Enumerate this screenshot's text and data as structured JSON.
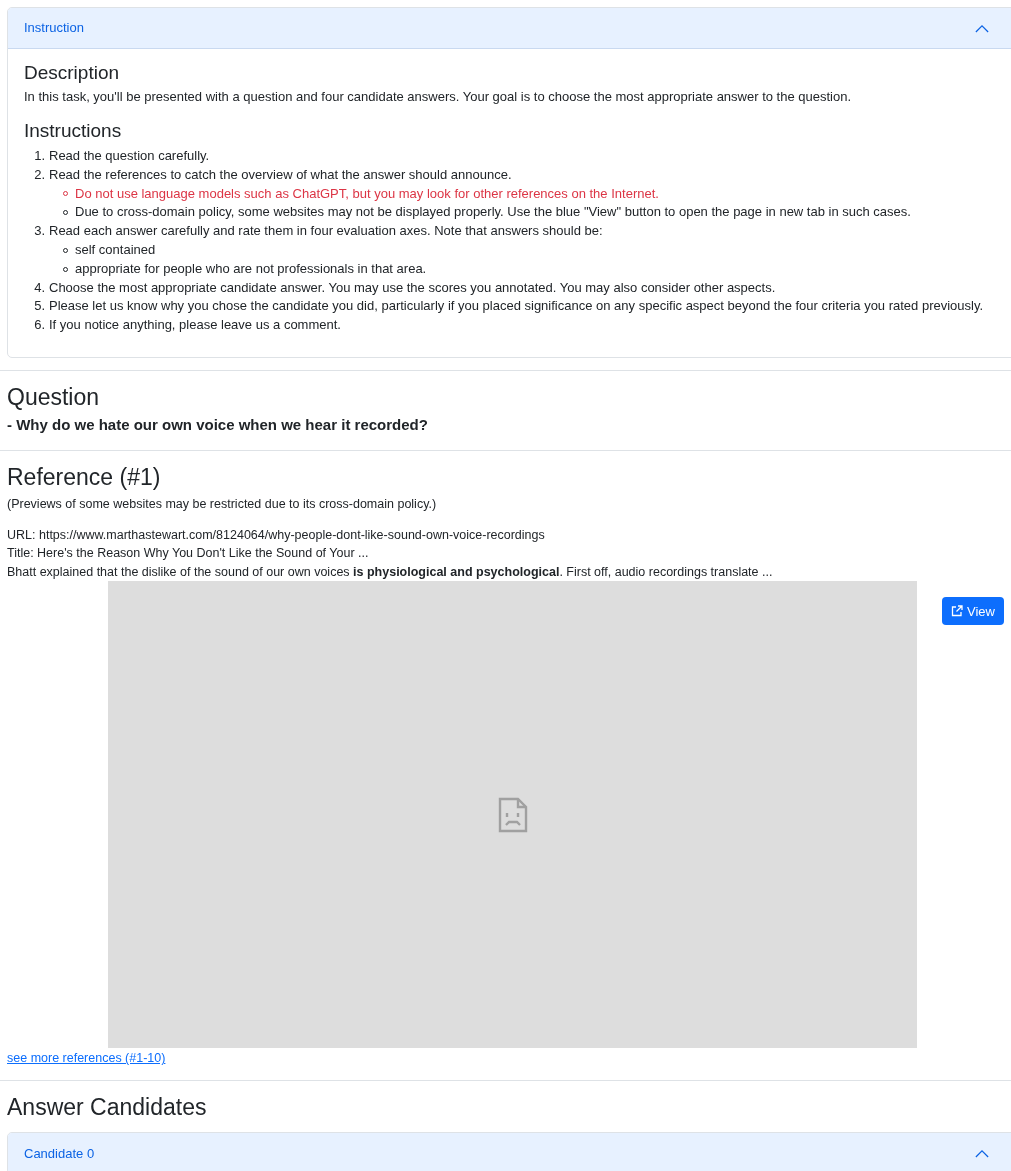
{
  "instruction_panel": {
    "header": "Instruction",
    "expanded": true,
    "description_heading": "Description",
    "description": "In this task, you'll be presented with a question and four candidate answers. Your goal is to choose the most appropriate answer to the question.",
    "instructions_heading": "Instructions",
    "steps": [
      {
        "number": "1.",
        "text": "Read the question carefully."
      },
      {
        "number": "2.",
        "text": "Read the references to catch the overview of what the answer should announce.",
        "children": [
          {
            "kind": "warning",
            "text": "Do not use language models such as ChatGPT, but you may look for other references on the Internet."
          },
          {
            "kind": "note",
            "text": "Due to cross-domain policy, some websites may not be displayed properly. Use the blue \"View\" button to open the page in new tab in such cases."
          }
        ]
      },
      {
        "number": "3.",
        "text": "Read each answer carefully and rate them in four evaluation axes. Note that answers should be:",
        "children": [
          {
            "kind": "note",
            "text": "self contained"
          },
          {
            "kind": "note",
            "text": "appropriate for people who are not professionals in that area."
          }
        ]
      },
      {
        "number": "4.",
        "text": "Choose the most appropriate candidate answer. You may use the scores you annotated. You may also consider other aspects."
      },
      {
        "number": "5.",
        "text": "Please let us know why you chose the candidate you did, particularly if you placed significance on any specific aspect beyond the four criteria you rated previously."
      },
      {
        "number": "6.",
        "text": "If you notice anything, please leave us a comment."
      }
    ]
  },
  "question": {
    "heading": "Question",
    "text": "- Why do we hate our own voice when we hear it recorded?"
  },
  "reference": {
    "heading": "Reference (#1)",
    "note": "(Previews of some websites may be restricted due to its cross-domain policy.)",
    "url": "URL: https://www.marthastewart.com/8124064/why-people-dont-like-sound-own-voice-recordings",
    "title": "Title: Here's the Reason Why You Don't Like the Sound of Your ...",
    "snippet": "Bhatt explained that the dislike of the sound of our own voices **is physiological and psychological**. First off, audio recordings translate ...",
    "view_button": "View",
    "more_link": "see more references (#1-10)"
  },
  "answers": {
    "heading": "Answer Candidates",
    "candidates": [
      {
        "header": "Candidate 0",
        "expanded": true
      }
    ]
  }
}
